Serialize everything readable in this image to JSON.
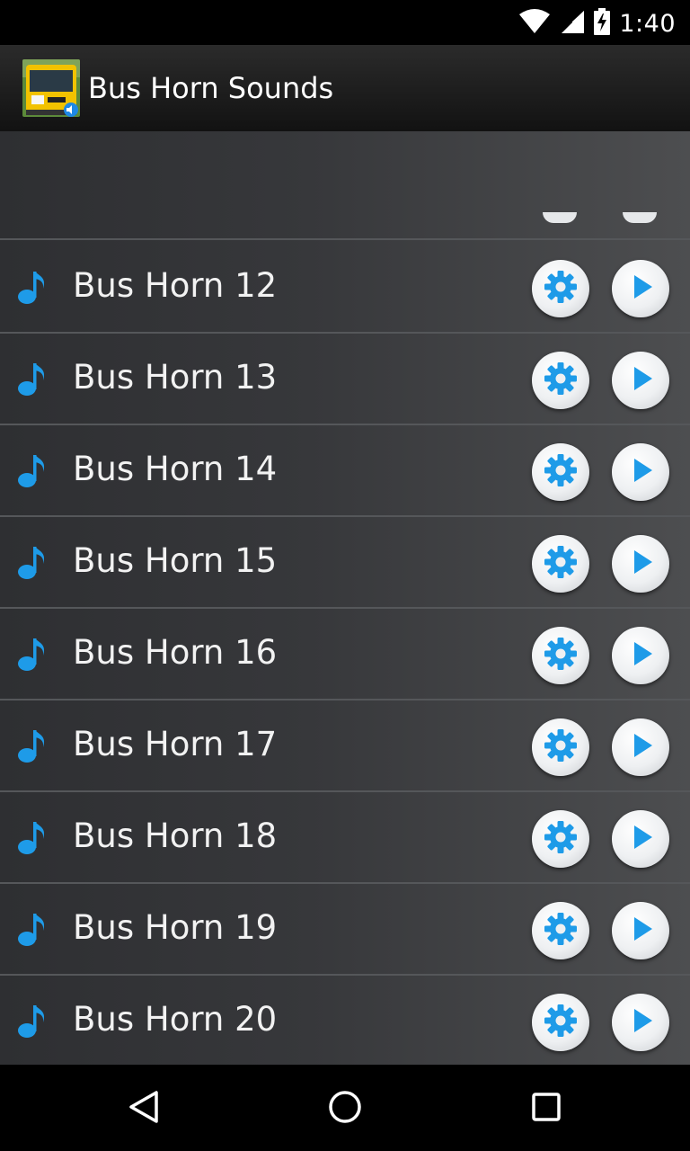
{
  "status_bar": {
    "time": "1:40",
    "icons": [
      "wifi-icon",
      "cell-signal-icon",
      "battery-charging-icon"
    ]
  },
  "action_bar": {
    "title": "Bus Horn Sounds",
    "icon": "bus-app-icon"
  },
  "list": {
    "items": [
      {
        "label": "Bus Horn 12"
      },
      {
        "label": "Bus Horn 13"
      },
      {
        "label": "Bus Horn 14"
      },
      {
        "label": "Bus Horn 15"
      },
      {
        "label": "Bus Horn 16"
      },
      {
        "label": "Bus Horn 17"
      },
      {
        "label": "Bus Horn 18"
      },
      {
        "label": "Bus Horn 19"
      },
      {
        "label": "Bus Horn 20"
      }
    ],
    "item_icon": "music-note-icon",
    "settings_icon": "gear-icon",
    "play_icon": "play-icon",
    "accent_color": "#1e9be8"
  },
  "nav_bar": {
    "buttons": [
      "back-icon",
      "home-icon",
      "recents-icon"
    ]
  }
}
